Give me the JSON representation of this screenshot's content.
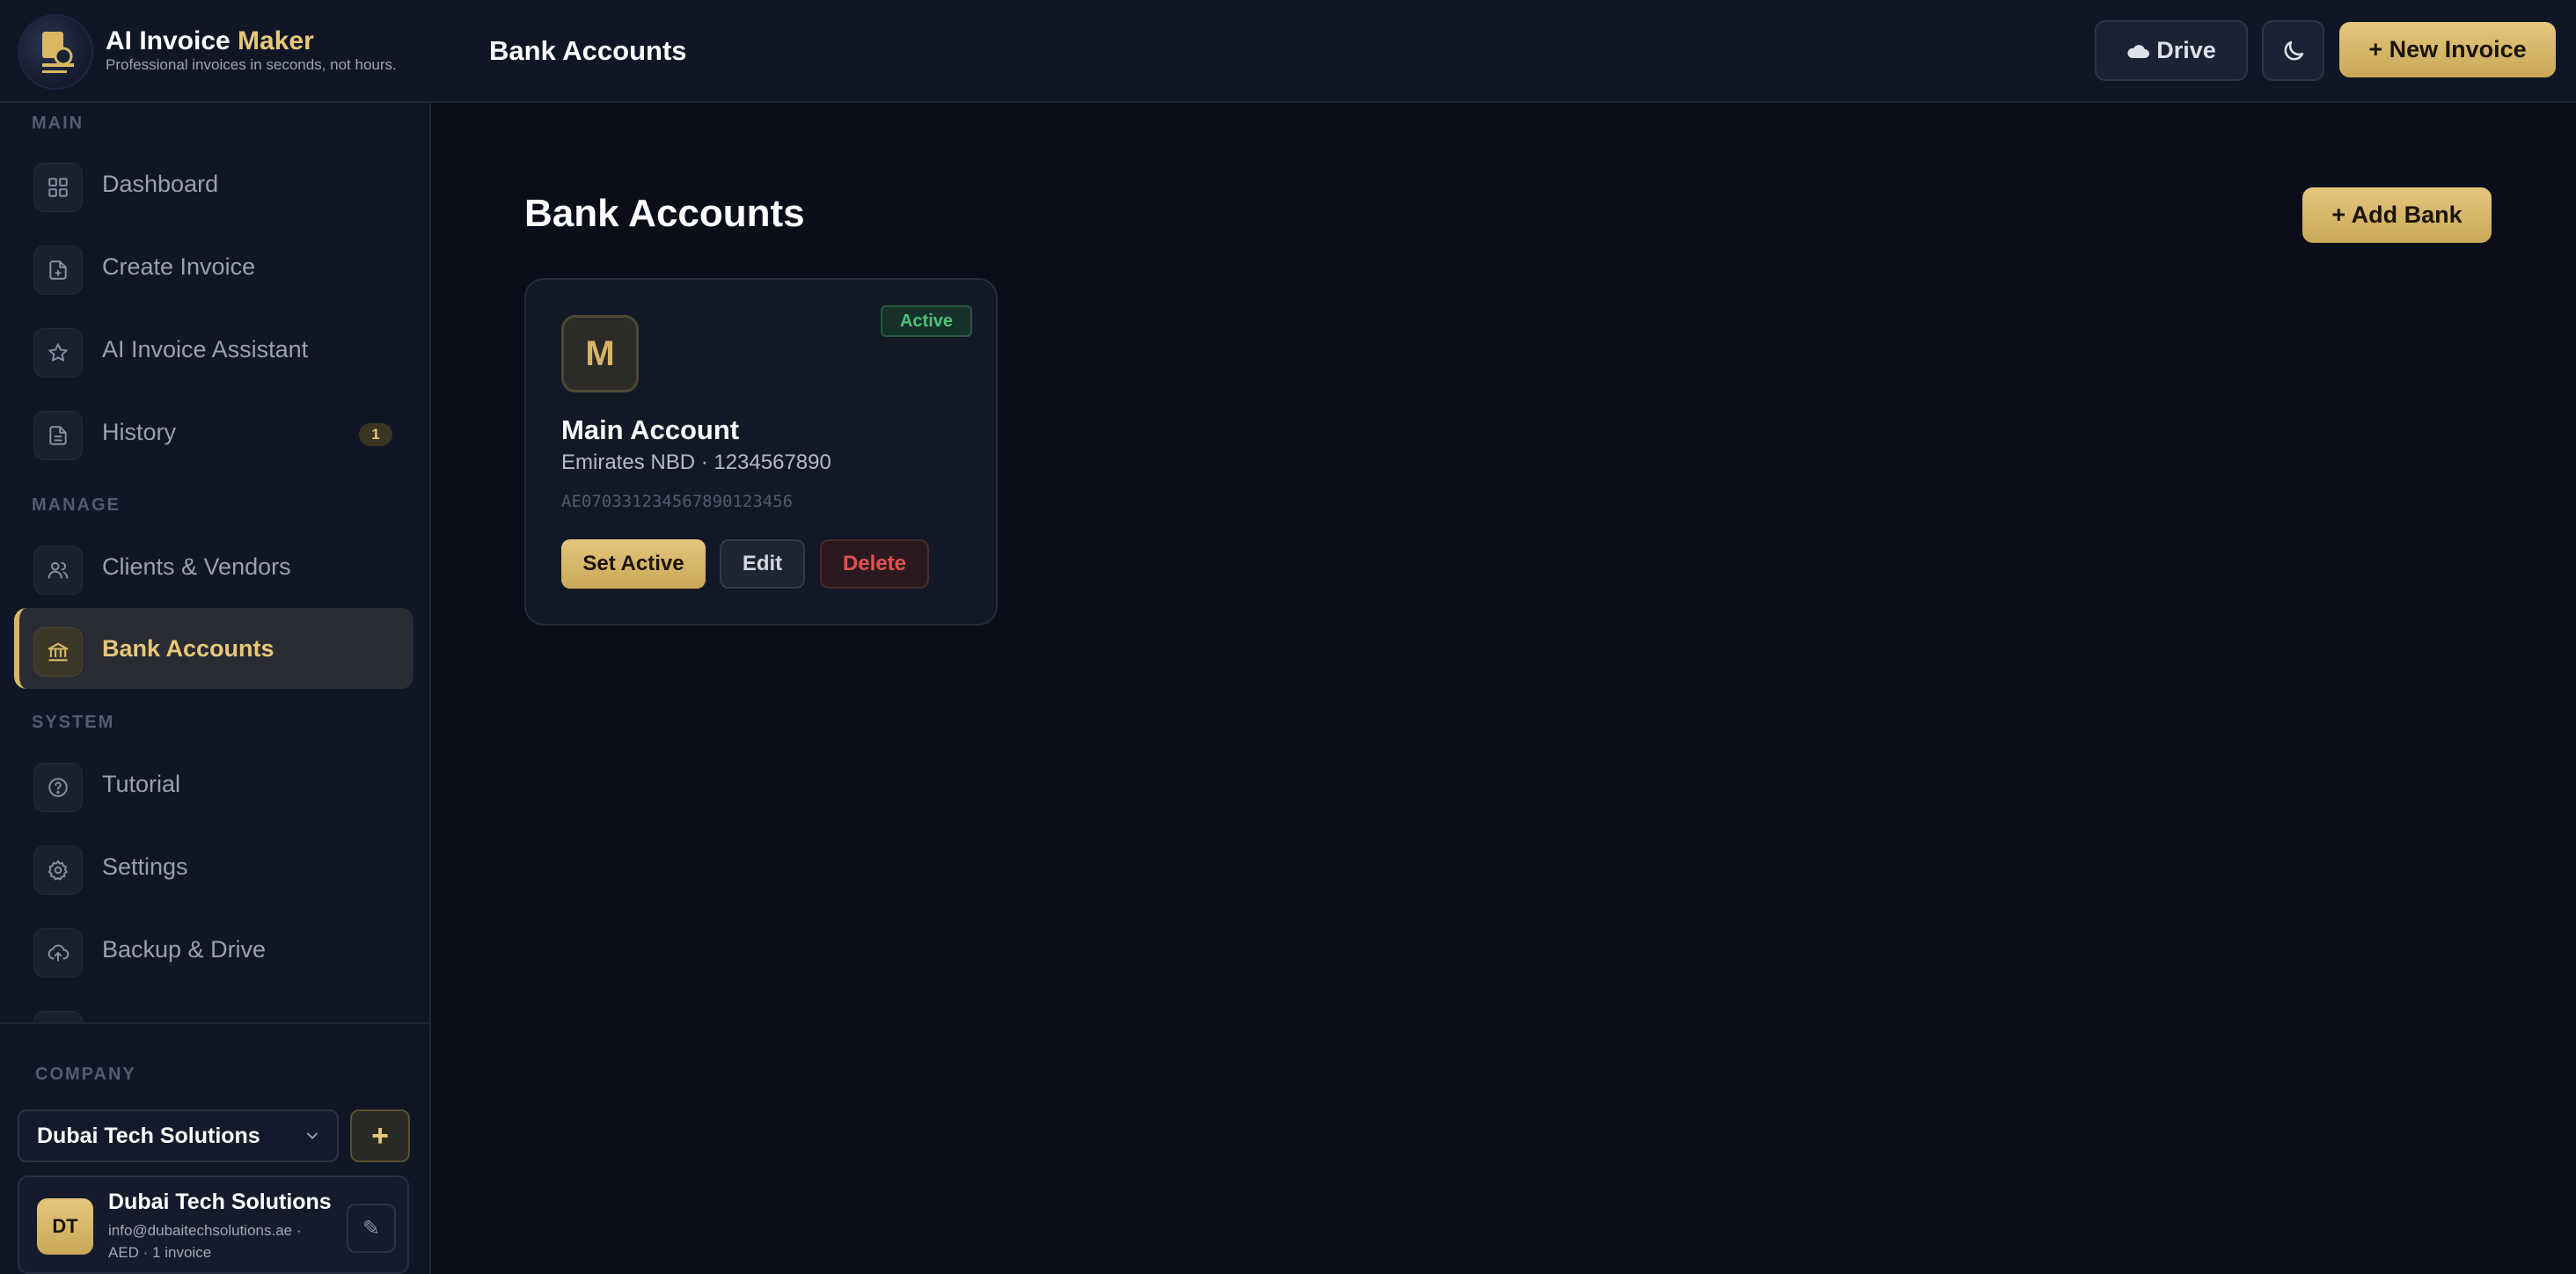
{
  "header": {
    "app_name_part1": "AI Invoice ",
    "app_name_part2": "Maker",
    "tagline": "Professional invoices in seconds, not hours.",
    "page_title": "Bank Accounts",
    "drive_label": "Drive",
    "new_invoice_label": "+ New Invoice",
    "theme_icon": "moon-icon"
  },
  "sidebar": {
    "sections": {
      "main": "MAIN",
      "manage": "MANAGE",
      "system": "SYSTEM"
    },
    "items": [
      {
        "label": "Dashboard",
        "icon": "grid-icon"
      },
      {
        "label": "Create Invoice",
        "icon": "file-plus-icon"
      },
      {
        "label": "AI Invoice Assistant",
        "icon": "star-icon"
      },
      {
        "label": "History",
        "icon": "document-icon",
        "badge": "1"
      },
      {
        "label": "Clients & Vendors",
        "icon": "users-icon"
      },
      {
        "label": "Bank Accounts",
        "icon": "bank-icon",
        "active": true
      },
      {
        "label": "Tutorial",
        "icon": "help-icon"
      },
      {
        "label": "Settings",
        "icon": "gear-icon"
      },
      {
        "label": "Backup & Drive",
        "icon": "cloud-upload-icon"
      }
    ]
  },
  "company": {
    "section_label": "COMPANY",
    "selected": "Dubai Tech Solutions",
    "add_label": "+",
    "card": {
      "initials": "DT",
      "name": "Dubai Tech Solutions",
      "email": "info@dubaitechsolutions.ae ·",
      "summary": "AED · 1 invoice",
      "edit_label": "✎"
    }
  },
  "main": {
    "title": "Bank Accounts",
    "add_bank_label": "+ Add Bank",
    "banks": [
      {
        "initial": "M",
        "status": "Active",
        "name": "Main Account",
        "bank_and_number": "Emirates NBD · 1234567890",
        "iban": "AE070331234567890123456",
        "actions": {
          "set_active": "Set Active",
          "edit": "Edit",
          "delete": "Delete"
        }
      }
    ]
  },
  "colors": {
    "background": "#0b0e1a",
    "panel": "#111627",
    "accent_gold": "#e5c67c",
    "active_green": "#4fc07a",
    "danger_red": "#e0524f"
  }
}
